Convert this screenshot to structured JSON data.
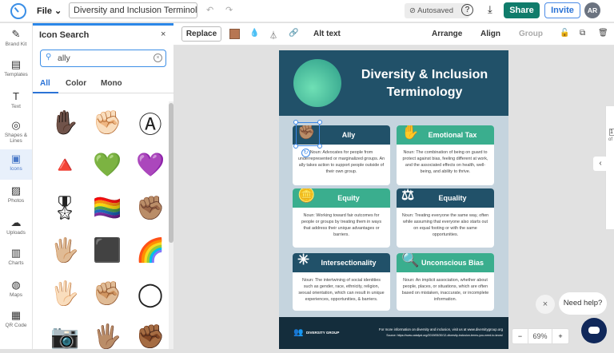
{
  "header": {
    "file_label": "File",
    "doc_title": "Diversity and Inclusion Terminolog...",
    "autosave": "Autosaved",
    "help": "?",
    "share": "Share",
    "invite": "Invite",
    "avatar": "AR"
  },
  "rail": [
    {
      "label": "Brand Kit",
      "icon": "✎"
    },
    {
      "label": "Templates",
      "icon": "▤"
    },
    {
      "label": "Text",
      "icon": "T"
    },
    {
      "label": "Shapes & Lines",
      "icon": "◎"
    },
    {
      "label": "Icons",
      "icon": "▣"
    },
    {
      "label": "Photos",
      "icon": "▨"
    },
    {
      "label": "Uploads",
      "icon": "☁"
    },
    {
      "label": "Charts",
      "icon": "▥"
    },
    {
      "label": "Maps",
      "icon": "◍"
    },
    {
      "label": "QR Code",
      "icon": "▦"
    }
  ],
  "panel": {
    "title": "Icon Search",
    "close": "×",
    "search_value": "ally",
    "tabs": [
      "All",
      "Color",
      "Mono"
    ],
    "icons": [
      "✋🏿",
      "✊🏻",
      "Ⓐ",
      "🔺",
      "💚",
      "💜",
      "🎖",
      "🏳️‍🌈",
      "✊🏽",
      "🖐🏼",
      "⬛",
      "🌈",
      "🖐🏻",
      "✊🏼",
      "◯",
      "📷",
      "🖐🏽",
      "✊🏾"
    ]
  },
  "toolbar": {
    "replace": "Replace",
    "alt_text": "Alt text",
    "arrange": "Arrange",
    "align": "Align",
    "group": "Group",
    "color": "#b77652"
  },
  "poster": {
    "title": "Diversity & Inclusion Terminology",
    "cards": [
      {
        "term": "Ally",
        "icon": "✊🏽",
        "style": "dark",
        "def": "Noun: Advocates for people from underrepresented or marginalized groups. An ally takes action to support people outside of their own group."
      },
      {
        "term": "Emotional Tax",
        "icon": "✋",
        "style": "green",
        "def": "Noun: The combination of being on guard to protect against bias, feeling different at work, and the associated effects on health, well-being, and ability to thrive."
      },
      {
        "term": "Equity",
        "icon": "🪙",
        "style": "green",
        "def": "Noun: Working toward fair outcomes for people or groups by treating them in ways that address their unique advantages or barriers."
      },
      {
        "term": "Equality",
        "icon": "⚖",
        "style": "dark",
        "def": "Noun: Treating everyone the same way, often while assuming that everyone also starts out on equal footing or with the same opportunities."
      },
      {
        "term": "Intersectionality",
        "icon": "✳",
        "style": "dark",
        "def": "Noun: The intertwining of social identities such as gender, race, ethnicity, religion, sexual orientation, which can result in unique experiences, opportunities, & barriers."
      },
      {
        "term": "Unconscious Bias",
        "icon": "🔍",
        "style": "green",
        "def": "Noun: An implicit association, whether about people, places, or situations, which are often based on mistaken, inaccurate, or incomplete information."
      }
    ],
    "footer_brand": "DIVERSITY GROUP",
    "footer_info": "For more information on diversity and inclusion, visit us at www.diversitygroup.org",
    "footer_source": "Source: https://www.catalyst.org/2019/05/30/12-diversity-inclusion-terms-you-need-to-know/"
  },
  "zoom": {
    "minus": "−",
    "value": "69%",
    "plus": "+"
  },
  "chat": {
    "label": "Need help?",
    "close": "×"
  },
  "page_nav": {
    "current": "1",
    "of": "of"
  }
}
